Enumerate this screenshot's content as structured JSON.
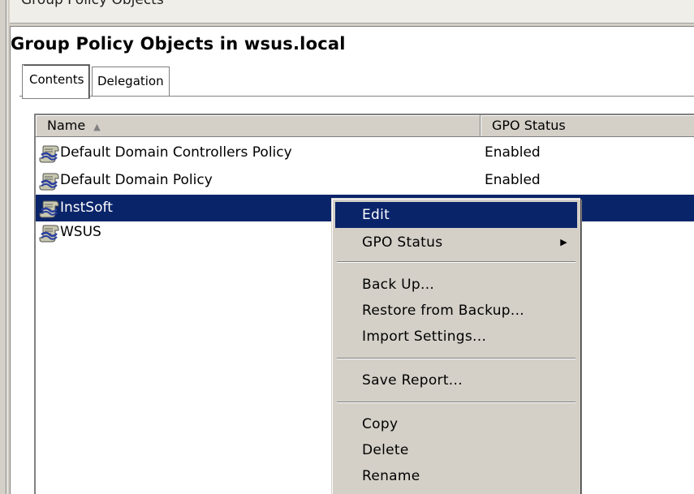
{
  "breadcrumb": {
    "text": "Group Policy Objects"
  },
  "title": "Group Policy Objects in wsus.local",
  "tabs": [
    {
      "label": "Contents",
      "active": true
    },
    {
      "label": "Delegation",
      "active": false
    }
  ],
  "columns": {
    "name": "Name",
    "status": "GPO Status",
    "sort_indicator": "▲"
  },
  "rows": [
    {
      "name": "Default Domain Controllers Policy",
      "status": "Enabled",
      "icon": "gpo-scroll-icon",
      "selected": false
    },
    {
      "name": "Default Domain Policy",
      "status": "Enabled",
      "icon": "gpo-scroll-icon",
      "selected": false
    },
    {
      "name": "InstSoft",
      "status": "",
      "icon": "gpo-scroll-icon",
      "selected": true
    },
    {
      "name": "WSUS",
      "status": "",
      "icon": "gpo-scroll-icon",
      "selected": false
    }
  ],
  "context_menu": {
    "items": [
      {
        "label": "Edit",
        "highlighted": true
      },
      {
        "label": "GPO Status",
        "submenu_arrow": "▶"
      },
      {
        "label": "Back Up..."
      },
      {
        "label": "Restore from Backup..."
      },
      {
        "label": "Import Settings..."
      },
      {
        "label": "Save Report..."
      },
      {
        "label": "Copy"
      },
      {
        "label": "Delete"
      },
      {
        "label": "Rename"
      }
    ]
  },
  "colors": {
    "selection": "#0a246a",
    "face": "#d4d0c8",
    "shadow": "#808080"
  }
}
